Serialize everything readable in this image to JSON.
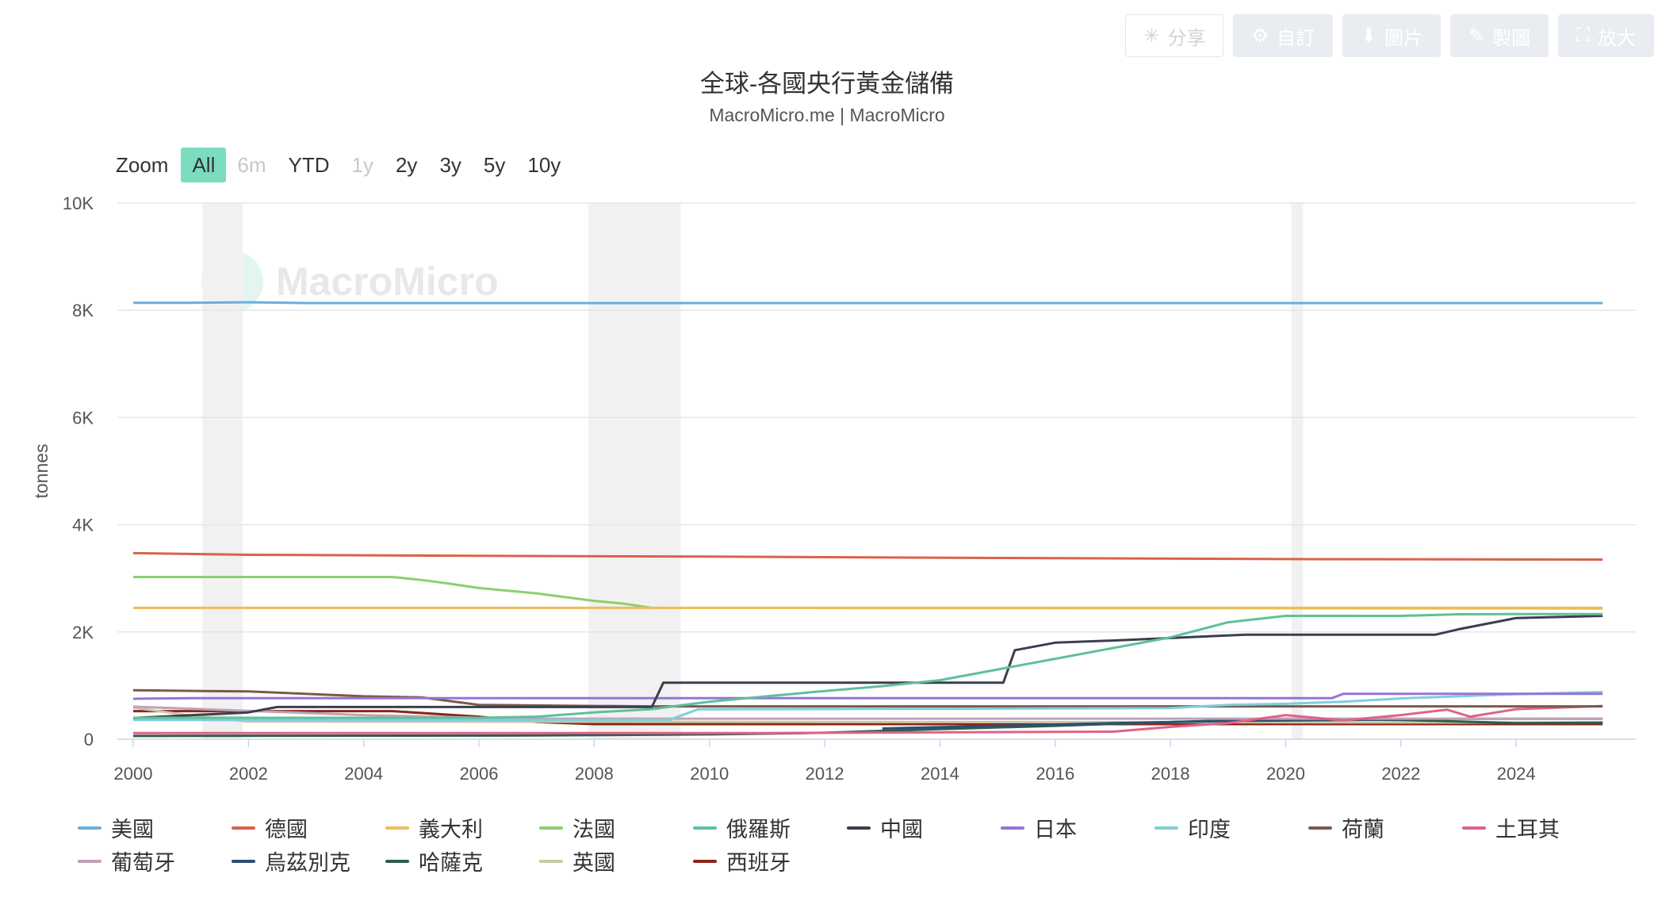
{
  "toolbar": {
    "buttons": [
      {
        "label": "分享",
        "icon": "share-icon",
        "glyph": "✳"
      },
      {
        "label": "自訂",
        "icon": "gear-icon",
        "glyph": "⚙"
      },
      {
        "label": "圖片",
        "icon": "download-icon",
        "glyph": "⬇"
      },
      {
        "label": "製圖",
        "icon": "pencil-icon",
        "glyph": "✎"
      },
      {
        "label": "放大",
        "icon": "expand-icon",
        "glyph": "⛶"
      }
    ]
  },
  "title": "全球-各國央行黃金儲備",
  "subtitle": "MacroMicro.me | MacroMicro",
  "watermark": "MacroMicro",
  "zoom": {
    "label": "Zoom",
    "options": [
      {
        "label": "All",
        "state": "active"
      },
      {
        "label": "6m",
        "state": "disabled"
      },
      {
        "label": "YTD",
        "state": "normal"
      },
      {
        "label": "1y",
        "state": "disabled"
      },
      {
        "label": "2y",
        "state": "normal"
      },
      {
        "label": "3y",
        "state": "normal"
      },
      {
        "label": "5y",
        "state": "normal"
      },
      {
        "label": "10y",
        "state": "normal"
      }
    ]
  },
  "chart_data": {
    "type": "line",
    "title": "全球-各國央行黃金儲備",
    "subtitle": "MacroMicro.me | MacroMicro",
    "ylabel": "tonnes",
    "xlabel": "",
    "xlim": [
      2000,
      2025.5
    ],
    "ylim": [
      0,
      10000
    ],
    "x_ticks": [
      "2000",
      "2002",
      "2004",
      "2006",
      "2008",
      "2010",
      "2012",
      "2014",
      "2016",
      "2018",
      "2020",
      "2022",
      "2024"
    ],
    "y_ticks": [
      "0",
      "2K",
      "4K",
      "6K",
      "8K",
      "10K"
    ],
    "grid": "horizontal",
    "legend_position": "bottom",
    "recession_bands": [
      [
        2001.2,
        2001.9
      ],
      [
        2007.9,
        2009.5
      ],
      [
        2020.1,
        2020.3
      ]
    ],
    "series": [
      {
        "name": "美國",
        "color": "#6aaedc",
        "points": [
          [
            2000,
            8140
          ],
          [
            2001,
            8140
          ],
          [
            2002,
            8150
          ],
          [
            2003,
            8135
          ],
          [
            2025.5,
            8135
          ]
        ]
      },
      {
        "name": "德國",
        "color": "#d9634a",
        "points": [
          [
            2000,
            3470
          ],
          [
            2002,
            3440
          ],
          [
            2006,
            3420
          ],
          [
            2010,
            3405
          ],
          [
            2015,
            3380
          ],
          [
            2020,
            3360
          ],
          [
            2025.5,
            3350
          ]
        ]
      },
      {
        "name": "義大利",
        "color": "#efbd55",
        "points": [
          [
            2000,
            2450
          ],
          [
            2025.5,
            2450
          ]
        ]
      },
      {
        "name": "法國",
        "color": "#8ccf70",
        "points": [
          [
            2000,
            3025
          ],
          [
            2004.5,
            3025
          ],
          [
            2005,
            2970
          ],
          [
            2005.5,
            2900
          ],
          [
            2006,
            2820
          ],
          [
            2007,
            2720
          ],
          [
            2008,
            2580
          ],
          [
            2008.5,
            2530
          ],
          [
            2009,
            2450
          ],
          [
            2025.5,
            2440
          ]
        ]
      },
      {
        "name": "俄羅斯",
        "color": "#5fbf9d",
        "points": [
          [
            2000,
            400
          ],
          [
            2006,
            400
          ],
          [
            2007,
            420
          ],
          [
            2008,
            500
          ],
          [
            2009,
            560
          ],
          [
            2010,
            700
          ],
          [
            2011,
            800
          ],
          [
            2012,
            900
          ],
          [
            2013,
            990
          ],
          [
            2014,
            1100
          ],
          [
            2015,
            1300
          ],
          [
            2016,
            1500
          ],
          [
            2017,
            1700
          ],
          [
            2018,
            1900
          ],
          [
            2019,
            2180
          ],
          [
            2020,
            2300
          ],
          [
            2021,
            2300
          ],
          [
            2022,
            2300
          ],
          [
            2023,
            2330
          ],
          [
            2024,
            2335
          ],
          [
            2025.5,
            2335
          ]
        ]
      },
      {
        "name": "中國",
        "color": "#3b3e4e",
        "points": [
          [
            2000,
            395
          ],
          [
            2002,
            500
          ],
          [
            2002.5,
            600
          ],
          [
            2009,
            600
          ],
          [
            2009.2,
            1054
          ],
          [
            2015.1,
            1054
          ],
          [
            2015.3,
            1660
          ],
          [
            2016,
            1800
          ],
          [
            2017,
            1840
          ],
          [
            2019.3,
            1950
          ],
          [
            2022.6,
            1950
          ],
          [
            2023,
            2050
          ],
          [
            2024,
            2260
          ],
          [
            2025.5,
            2300
          ]
        ]
      },
      {
        "name": "日本",
        "color": "#9674d6",
        "points": [
          [
            2000,
            754
          ],
          [
            2001,
            765
          ],
          [
            2020.8,
            765
          ],
          [
            2021,
            846
          ],
          [
            2025.5,
            846
          ]
        ]
      },
      {
        "name": "印度",
        "color": "#7ecfd9",
        "points": [
          [
            2000,
            358
          ],
          [
            2009.3,
            358
          ],
          [
            2009.8,
            558
          ],
          [
            2018,
            580
          ],
          [
            2019,
            640
          ],
          [
            2020,
            660
          ],
          [
            2021,
            700
          ],
          [
            2022,
            760
          ],
          [
            2023,
            800
          ],
          [
            2024,
            840
          ],
          [
            2025.5,
            880
          ]
        ]
      },
      {
        "name": "荷蘭",
        "color": "#7a5a4a",
        "points": [
          [
            2000,
            912
          ],
          [
            2002,
            890
          ],
          [
            2004,
            800
          ],
          [
            2005,
            780
          ],
          [
            2006,
            640
          ],
          [
            2008,
            620
          ],
          [
            2009,
            612
          ],
          [
            2025.5,
            612
          ]
        ]
      },
      {
        "name": "土耳其",
        "color": "#e0628a",
        "points": [
          [
            2000,
            116
          ],
          [
            2011,
            116
          ],
          [
            2017,
            140
          ],
          [
            2018,
            230
          ],
          [
            2019,
            300
          ],
          [
            2020,
            450
          ],
          [
            2021,
            350
          ],
          [
            2022,
            450
          ],
          [
            2022.8,
            550
          ],
          [
            2023.2,
            420
          ],
          [
            2024,
            560
          ],
          [
            2025.5,
            620
          ]
        ]
      },
      {
        "name": "葡萄牙",
        "color": "#c0a1b8",
        "points": [
          [
            2000,
            607
          ],
          [
            2004,
            450
          ],
          [
            2006,
            400
          ],
          [
            2007,
            383
          ],
          [
            2025.5,
            383
          ]
        ]
      },
      {
        "name": "烏茲別克",
        "color": "#2e4f73",
        "points": [
          [
            2013,
            200
          ],
          [
            2015,
            250
          ],
          [
            2017,
            300
          ],
          [
            2019,
            340
          ],
          [
            2021,
            360
          ],
          [
            2023,
            380
          ],
          [
            2025.5,
            380
          ]
        ]
      },
      {
        "name": "哈薩克",
        "color": "#2d5e4a",
        "points": [
          [
            2000,
            60
          ],
          [
            2007,
            70
          ],
          [
            2010,
            90
          ],
          [
            2012,
            120
          ],
          [
            2014,
            190
          ],
          [
            2016,
            250
          ],
          [
            2018,
            320
          ],
          [
            2020,
            380
          ],
          [
            2022,
            360
          ],
          [
            2024,
            300
          ],
          [
            2025.5,
            310
          ]
        ]
      },
      {
        "name": "英國",
        "color": "#c9c9a3",
        "points": [
          [
            2000,
            590
          ],
          [
            2001,
            440
          ],
          [
            2002,
            330
          ],
          [
            2025.5,
            310
          ]
        ]
      },
      {
        "name": "西班牙",
        "color": "#8e2419",
        "points": [
          [
            2000,
            523
          ],
          [
            2004.5,
            523
          ],
          [
            2006,
            420
          ],
          [
            2007,
            320
          ],
          [
            2008,
            281
          ],
          [
            2025.5,
            281
          ]
        ]
      }
    ]
  }
}
